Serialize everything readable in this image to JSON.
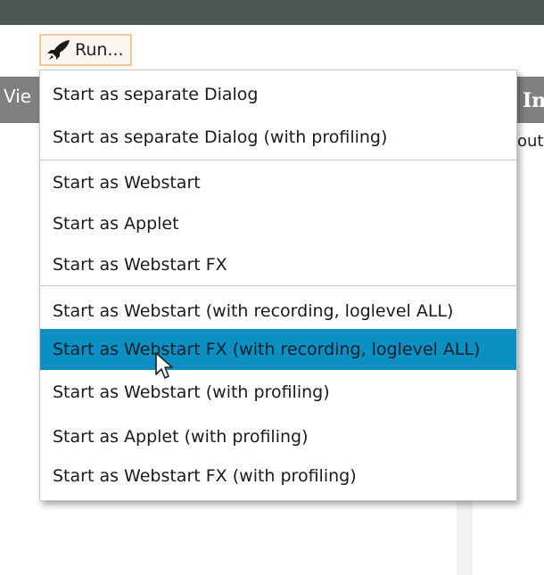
{
  "toolbar": {
    "run_label": "Run...",
    "run_icon": "rocket-icon"
  },
  "background": {
    "header_left_text": "Vie",
    "header_right_text": "In",
    "right_subtext": "out"
  },
  "menu": {
    "items": [
      {
        "label": "Start as separate Dialog"
      },
      {
        "label": "Start as separate Dialog (with profiling)"
      },
      {
        "label": "Start as Webstart"
      },
      {
        "label": "Start as Applet"
      },
      {
        "label": "Start as Webstart FX"
      },
      {
        "label": "Start as Webstart (with recording, loglevel ALL)"
      },
      {
        "label": "Start as Webstart FX (with recording, loglevel ALL)",
        "highlighted": true
      },
      {
        "label": "Start as Webstart (with profiling)"
      },
      {
        "label": "Start as Applet (with profiling)"
      },
      {
        "label": "Start as Webstart FX (with profiling)"
      }
    ]
  },
  "colors": {
    "top_bar": "#4f5756",
    "header_strip": "#808080",
    "highlight": "#0c8fc3",
    "button_border": "#f1c99a"
  }
}
